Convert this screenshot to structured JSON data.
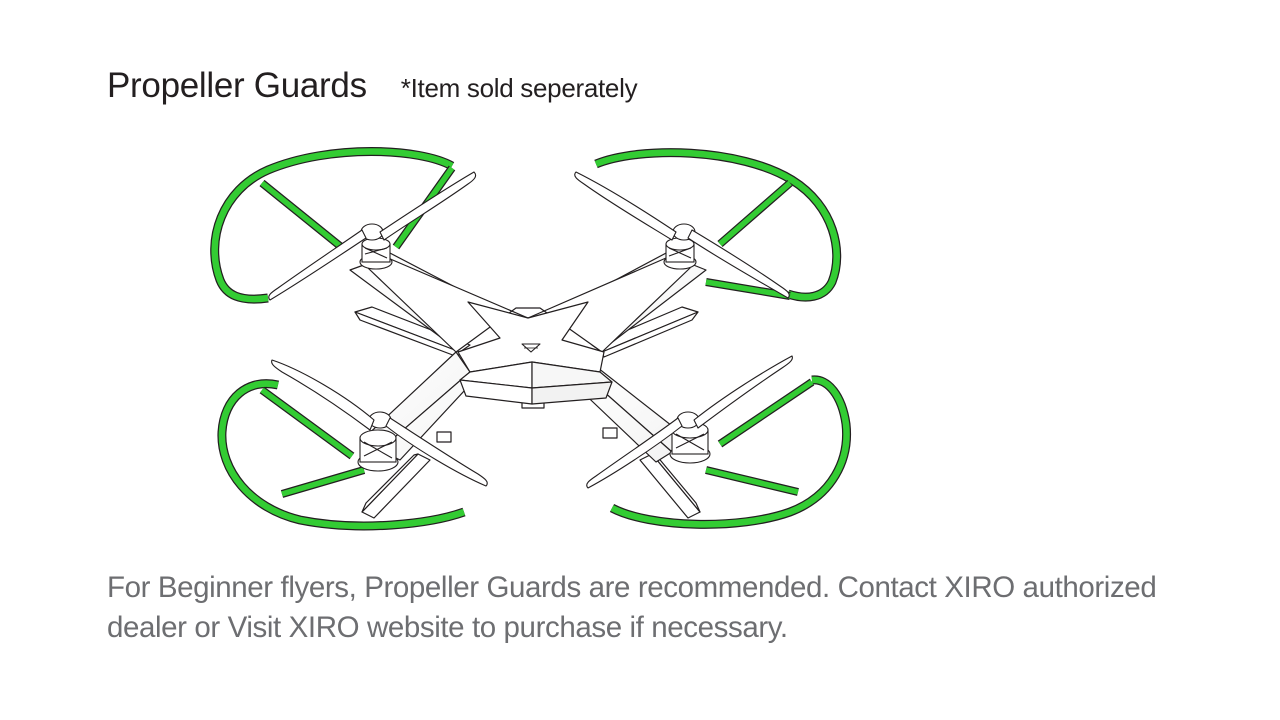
{
  "heading": {
    "title": "Propeller Guards",
    "note": "*Item sold seperately"
  },
  "illustration": {
    "subject": "drone-with-propeller-guards",
    "guard_color": "#33cc33",
    "outline_color": "#231f20"
  },
  "description": "For Beginner flyers, Propeller Guards are recommended. Contact XIRO authorized dealer or Visit XIRO website to purchase if necessary."
}
